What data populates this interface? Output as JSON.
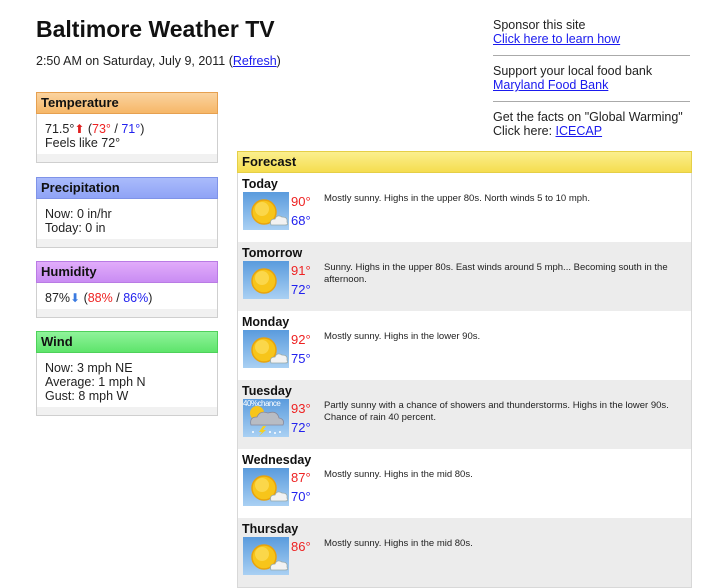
{
  "header": {
    "title": "Baltimore Weather TV",
    "timestamp": "2:50 AM on Saturday, July 9, 2011",
    "refresh_label": "Refresh"
  },
  "temperature": {
    "title": "Temperature",
    "current": "71.5°",
    "trend": "up",
    "high": "73°",
    "low": "71°",
    "feels_like": "Feels like 72°"
  },
  "precipitation": {
    "title": "Precipitation",
    "now": "Now: 0 in/hr",
    "today": "Today: 0 in"
  },
  "humidity": {
    "title": "Humidity",
    "current": "87%",
    "trend": "down",
    "high": "88%",
    "low": "86%"
  },
  "wind": {
    "title": "Wind",
    "now": "Now: 3 mph NE",
    "average": "Average: 1 mph N",
    "gust": "Gust: 8 mph W"
  },
  "sponsor": {
    "line1": "Sponsor this site",
    "link1": "Click here to learn how",
    "line2": "Support your local food bank",
    "link2": "Maryland Food Bank",
    "line3": "Get the facts on \"Global Warming\"",
    "line3b": "Click here: ",
    "link3": "ICECAP"
  },
  "forecast": {
    "title": "Forecast",
    "days": [
      {
        "day": "Today",
        "icon": "mostly-sunny-icon",
        "high": "90°",
        "low": "68°",
        "text": "Mostly sunny. Highs in the upper 80s. North winds 5 to 10 mph."
      },
      {
        "day": "Tomorrow",
        "icon": "sunny-icon",
        "high": "91°",
        "low": "72°",
        "text": "Sunny. Highs in the upper 80s. East winds around 5 mph... Becoming south in the afternoon."
      },
      {
        "day": "Monday",
        "icon": "mostly-sunny-icon",
        "high": "92°",
        "low": "75°",
        "text": "Mostly sunny. Highs in the lower 90s."
      },
      {
        "day": "Tuesday",
        "icon": "thunderstorm-icon",
        "chance": "40%chance",
        "high": "93°",
        "low": "72°",
        "text": "Partly sunny with a chance of showers and thunderstorms. Highs in the lower 90s. Chance of rain 40 percent."
      },
      {
        "day": "Wednesday",
        "icon": "mostly-sunny-icon",
        "high": "87°",
        "low": "70°",
        "text": "Mostly sunny. Highs in the mid 80s."
      },
      {
        "day": "Thursday",
        "icon": "mostly-sunny-icon",
        "high": "86°",
        "low": "",
        "text": "Mostly sunny. Highs in the mid 80s."
      }
    ]
  }
}
